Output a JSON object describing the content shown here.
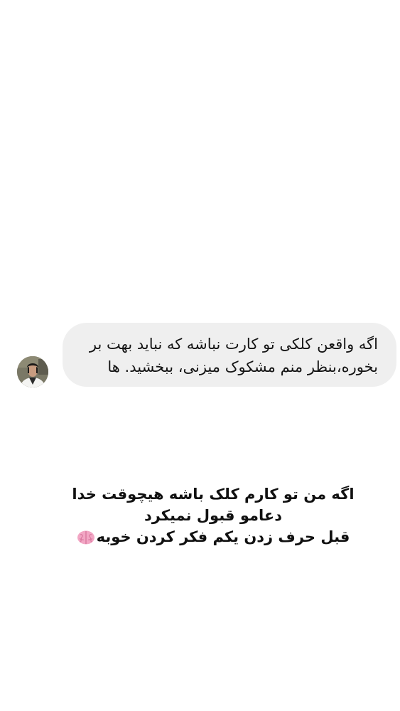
{
  "message": {
    "line1": "اگه واقعن کلکی تو کارت نباشه که نباید بهت بر",
    "line2": "بخوره،بنظر منم مشکوک میزنی، ببخشید. ها"
  },
  "reply": {
    "line1": "اگه من تو کارم کلک باشه هیچوقت خدا",
    "line2": "دعامو قبول نمیکرد",
    "line3": "قبل حرف زدن یکم فکر کردن خوبه"
  },
  "icons": {
    "avatar": "profile-photo",
    "emoji": "brain-icon"
  },
  "colors": {
    "background": "#ffffff",
    "bubble": "#efefef",
    "text": "#141414",
    "emoji": "#f2a6c4"
  }
}
